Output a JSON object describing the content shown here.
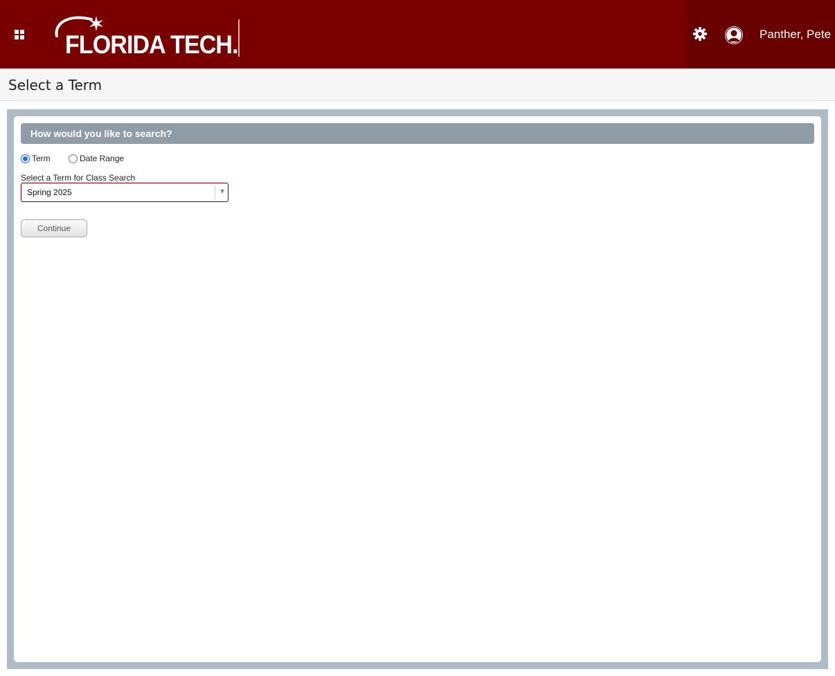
{
  "header": {
    "logo_text": "FLORIDA TECH.",
    "user_name": "Panther, Pete",
    "colors": {
      "brand": "#7a0000",
      "user_zone": "#680000"
    },
    "icons": [
      "apps-grid-icon",
      "gear-icon",
      "user-avatar-icon"
    ]
  },
  "page": {
    "title": "Select a Term"
  },
  "search": {
    "heading": "How would you like to search?",
    "options": [
      {
        "label": "Term",
        "checked": true
      },
      {
        "label": "Date Range",
        "checked": false
      }
    ],
    "term_field_label": "Select a Term for Class Search",
    "term_value": "Spring 2025",
    "continue_label": "Continue"
  }
}
